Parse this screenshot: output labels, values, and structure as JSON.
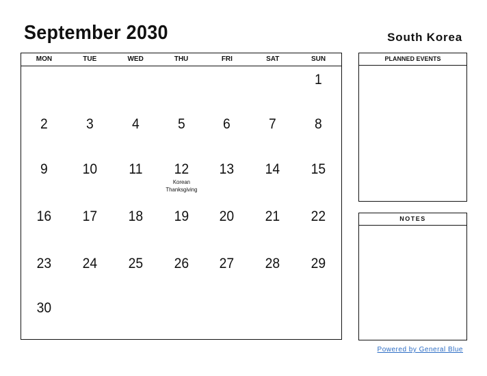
{
  "header": {
    "title": "September 2030",
    "country": "South Korea"
  },
  "calendar": {
    "weekdays": [
      "MON",
      "TUE",
      "WED",
      "THU",
      "FRI",
      "SAT",
      "SUN"
    ],
    "weeks": [
      [
        {
          "d": ""
        },
        {
          "d": ""
        },
        {
          "d": ""
        },
        {
          "d": ""
        },
        {
          "d": ""
        },
        {
          "d": ""
        },
        {
          "d": "1"
        }
      ],
      [
        {
          "d": "2"
        },
        {
          "d": "3"
        },
        {
          "d": "4"
        },
        {
          "d": "5"
        },
        {
          "d": "6"
        },
        {
          "d": "7"
        },
        {
          "d": "8"
        }
      ],
      [
        {
          "d": "9"
        },
        {
          "d": "10"
        },
        {
          "d": "11"
        },
        {
          "d": "12",
          "event": "Korean Thanksgiving"
        },
        {
          "d": "13"
        },
        {
          "d": "14"
        },
        {
          "d": "15"
        }
      ],
      [
        {
          "d": "16"
        },
        {
          "d": "17"
        },
        {
          "d": "18"
        },
        {
          "d": "19"
        },
        {
          "d": "20"
        },
        {
          "d": "21"
        },
        {
          "d": "22"
        }
      ],
      [
        {
          "d": "23"
        },
        {
          "d": "24"
        },
        {
          "d": "25"
        },
        {
          "d": "26"
        },
        {
          "d": "27"
        },
        {
          "d": "28"
        },
        {
          "d": "29"
        }
      ],
      [
        {
          "d": "30"
        },
        {
          "d": ""
        },
        {
          "d": ""
        },
        {
          "d": ""
        },
        {
          "d": ""
        },
        {
          "d": ""
        },
        {
          "d": ""
        }
      ]
    ]
  },
  "panels": {
    "planned_events": "PLANNED EVENTS",
    "notes": "NOTES"
  },
  "footer": {
    "powered_by": "Powered by General Blue",
    "link_color": "#2b6cc4"
  }
}
